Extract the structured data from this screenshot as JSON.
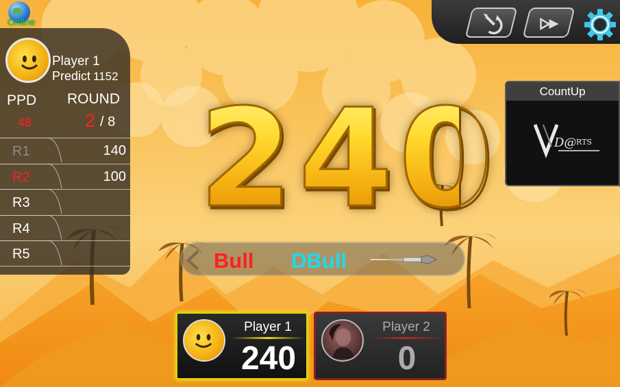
{
  "status": {
    "label": "Online",
    "icon": "globe-icon"
  },
  "player_panel": {
    "name": "Player 1",
    "predict_label": "Predict",
    "predict_value": "1152",
    "ppd_header": "PPD",
    "round_header": "ROUND",
    "ppd_value": "48",
    "round_current": "2",
    "round_total": "/ 8",
    "rounds": [
      {
        "label": "R1",
        "score": "140"
      },
      {
        "label": "R2",
        "score": "100"
      },
      {
        "label": "R3",
        "score": ""
      },
      {
        "label": "R4",
        "score": ""
      },
      {
        "label": "R5",
        "score": ""
      }
    ]
  },
  "toolbar": {
    "icons": [
      "dart-undo-icon",
      "skip-forward-icon",
      "gear-icon"
    ]
  },
  "game_mode": {
    "title": "CountUp",
    "logo_text": "VDarts"
  },
  "main_score": "240",
  "throws": [
    "Bull",
    "DBull",
    ""
  ],
  "players": [
    {
      "name": "Player 1",
      "score": "240",
      "active": true
    },
    {
      "name": "Player 2",
      "score": "0",
      "active": false
    }
  ],
  "colors": {
    "background": "#f6b53c",
    "score_gold": "#f7c51c",
    "highlight_red": "#ff2020",
    "bull_red": "#ff1f1f",
    "dbull_cyan": "#1fd9ee",
    "active_border": "#e0d10e",
    "inactive_border": "#8a2222"
  }
}
